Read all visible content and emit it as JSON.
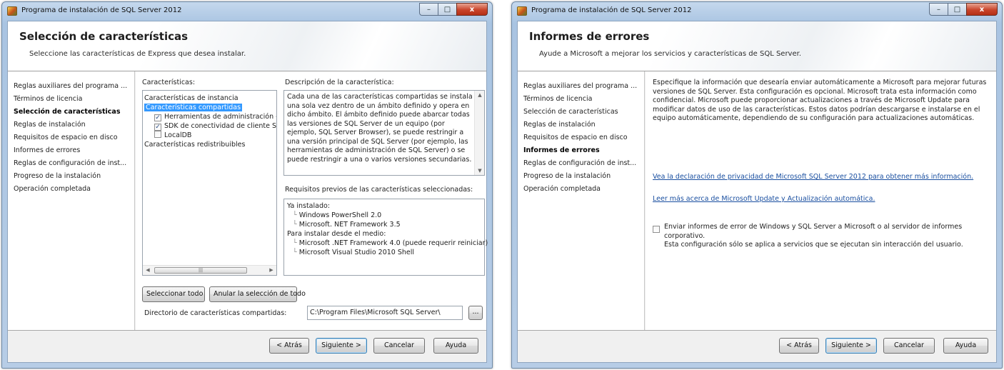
{
  "window1": {
    "title": "Programa de instalación de SQL Server 2012",
    "header": {
      "title": "Selección de características",
      "subtitle": "Seleccione las características de Express que desea instalar."
    },
    "steps": [
      {
        "label": "Reglas auxiliares del programa ...",
        "active": false
      },
      {
        "label": "Términos de licencia",
        "active": false
      },
      {
        "label": "Selección de características",
        "active": true
      },
      {
        "label": "Reglas de instalación",
        "active": false
      },
      {
        "label": "Requisitos de espacio en disco",
        "active": false
      },
      {
        "label": "Informes de errores",
        "active": false
      },
      {
        "label": "Reglas de configuración de inst...",
        "active": false
      },
      {
        "label": "Progreso de la instalación",
        "active": false
      },
      {
        "label": "Operación completada",
        "active": false
      }
    ],
    "features_label": "Características:",
    "features": {
      "instance": "Características de instancia",
      "shared": "Características compartidas",
      "items": [
        {
          "label": "Herramientas de administración - B",
          "checked": true
        },
        {
          "label": "SDK de conectividad de cliente SQL",
          "checked": true
        },
        {
          "label": "LocalDB",
          "checked": false
        }
      ],
      "redist": "Características redistribuibles"
    },
    "description_label": "Descripción de la característica:",
    "description": "Cada una de las características compartidas se instala una sola vez dentro de un ámbito definido y opera en dicho ámbito. El ámbito definido puede abarcar todas las versiones de SQL Server de un equipo (por ejemplo, SQL Server Browser), se puede restringir a una versión principal de SQL Server (por ejemplo, las herramientas de administración de SQL Server) o se puede restringir a una o varios versiones secundarias.",
    "prereq_label": "Requisitos previos de las características seleccionadas:",
    "prereq": {
      "installed_label": "Ya instalado:",
      "installed": [
        "Windows PowerShell 2.0",
        "Microsoft. NET Framework 3.5"
      ],
      "to_install_label": "Para instalar desde el medio:",
      "to_install": [
        "Microsoft .NET Framework 4.0 (puede requerir reiniciar)",
        "Microsoft Visual Studio 2010 Shell"
      ]
    },
    "select_all": "Seleccionar todo",
    "unselect_all": "Anular la selección de todo",
    "dir_label": "Directorio de características compartidas:",
    "dir_value": "C:\\Program Files\\Microsoft SQL Server\\",
    "browse": "...",
    "buttons": {
      "back": "< Atrás",
      "next": "Siguiente >",
      "cancel": "Cancelar",
      "help": "Ayuda"
    }
  },
  "window2": {
    "title": "Programa de instalación de SQL Server 2012",
    "header": {
      "title": "Informes de errores",
      "subtitle": "Ayude a Microsoft a mejorar los servicios y características de SQL Server."
    },
    "steps": [
      {
        "label": "Reglas auxiliares del programa ...",
        "active": false
      },
      {
        "label": "Términos de licencia",
        "active": false
      },
      {
        "label": "Selección de características",
        "active": false
      },
      {
        "label": "Reglas de instalación",
        "active": false
      },
      {
        "label": "Requisitos de espacio en disco",
        "active": false
      },
      {
        "label": "Informes de errores",
        "active": true
      },
      {
        "label": "Reglas de configuración de inst...",
        "active": false
      },
      {
        "label": "Progreso de la instalación",
        "active": false
      },
      {
        "label": "Operación completada",
        "active": false
      }
    ],
    "intro": "Especifique la información que desearía enviar automáticamente a Microsoft para mejorar futuras versiones de SQL Server. Esta configuración es opcional. Microsoft trata esta información como confidencial. Microsoft puede proporcionar actualizaciones a través de Microsoft Update para modificar datos de uso de las características. Estos datos podrían descargarse e instalarse en el equipo automáticamente, dependiendo de su configuración para actualizaciones automáticas.",
    "privacy_link": "Vea la declaración de privacidad de Microsoft SQL Server 2012 para obtener más información.",
    "update_link": "Leer más acerca de Microsoft Update y Actualización automática.",
    "report_checkbox": {
      "checked": false,
      "line1": "Enviar informes de error de Windows y SQL Server a Microsoft o al servidor de informes corporativo.",
      "line2": "Esta configuración sólo se aplica a servicios que se ejecutan sin interacción del usuario."
    },
    "buttons": {
      "back": "< Atrás",
      "next": "Siguiente >",
      "cancel": "Cancelar",
      "help": "Ayuda"
    }
  },
  "caption": {
    "minimize": "–",
    "maximize": "□",
    "close": "x"
  }
}
